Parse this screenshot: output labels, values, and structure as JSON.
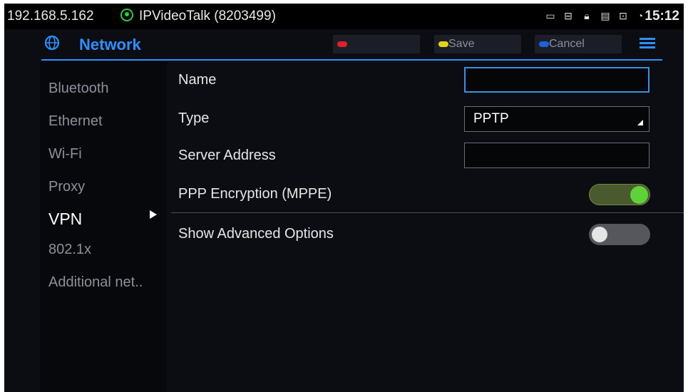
{
  "status_bar": {
    "ip_address": "192.168.5.162",
    "account_icon": "account-circle-icon",
    "account_label": "IPVideoTalk (8203499)",
    "icons": [
      "screen-icon",
      "network-icon",
      "lock-icon",
      "sim-icon",
      "chat-icon",
      "wifi-icon"
    ],
    "time": "15:12"
  },
  "header": {
    "icon": "network-globe-icon",
    "title": "Network",
    "buttons": [
      {
        "label": "",
        "dot_color": "#e0202a"
      },
      {
        "label": "Save",
        "dot_color": "#e6d21a"
      },
      {
        "label": "Cancel",
        "dot_color": "#1f5fe0"
      }
    ],
    "menu_icon": "menu-icon",
    "accent_color": "#2e8fff"
  },
  "sidebar": {
    "items": [
      {
        "label": "Bluetooth",
        "active": false
      },
      {
        "label": "Ethernet",
        "active": false
      },
      {
        "label": "Wi-Fi",
        "active": false
      },
      {
        "label": "Proxy",
        "active": false
      },
      {
        "label": "VPN",
        "active": true
      },
      {
        "label": "802.1x",
        "active": false
      },
      {
        "label": "Additional net.."
      }
    ]
  },
  "form": {
    "name_label": "Name",
    "name_value": "",
    "type_label": "Type",
    "type_value": "PPTP",
    "server_label": "Server Address",
    "server_value": "",
    "mppe_label": "PPP Encryption (MPPE)",
    "mppe_on": true,
    "advanced_label": "Show Advanced Options",
    "advanced_on": false
  }
}
